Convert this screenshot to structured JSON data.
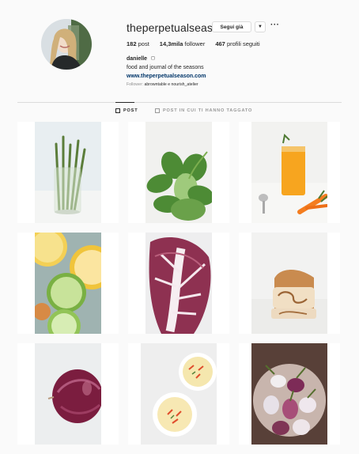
{
  "profile": {
    "username": "theperpetualseason",
    "follow_label": "Segui già",
    "dropdown_icon": "chevron-down-icon",
    "more_icon": "more-icon"
  },
  "stats": {
    "posts_count": "182",
    "posts_label": "post",
    "followers_count": "14,3mila",
    "followers_label": "follower",
    "following_count": "467",
    "following_label": "profili seguiti"
  },
  "bio": {
    "name": "danielle",
    "text": "food and journal of the seasons",
    "website": "www.theperpetualseason.com",
    "followed_by_label": "Follower:",
    "followed_by": "abrowntable e nourish_atelier"
  },
  "tabs": [
    {
      "label": "POST",
      "icon": "grid-icon",
      "active": true
    },
    {
      "label": "POST IN CUI TI HANNO TAGGATO",
      "icon": "tagged-icon",
      "active": false
    }
  ],
  "posts": [
    {
      "subject": "asparagus-glass"
    },
    {
      "subject": "pea-shoots"
    },
    {
      "subject": "orange-juice-carrots"
    },
    {
      "subject": "citrus-slices"
    },
    {
      "subject": "radicchio-leaf"
    },
    {
      "subject": "swirl-bread"
    },
    {
      "subject": "red-onion"
    },
    {
      "subject": "soup-bowls"
    },
    {
      "subject": "radishes-bowl"
    }
  ]
}
